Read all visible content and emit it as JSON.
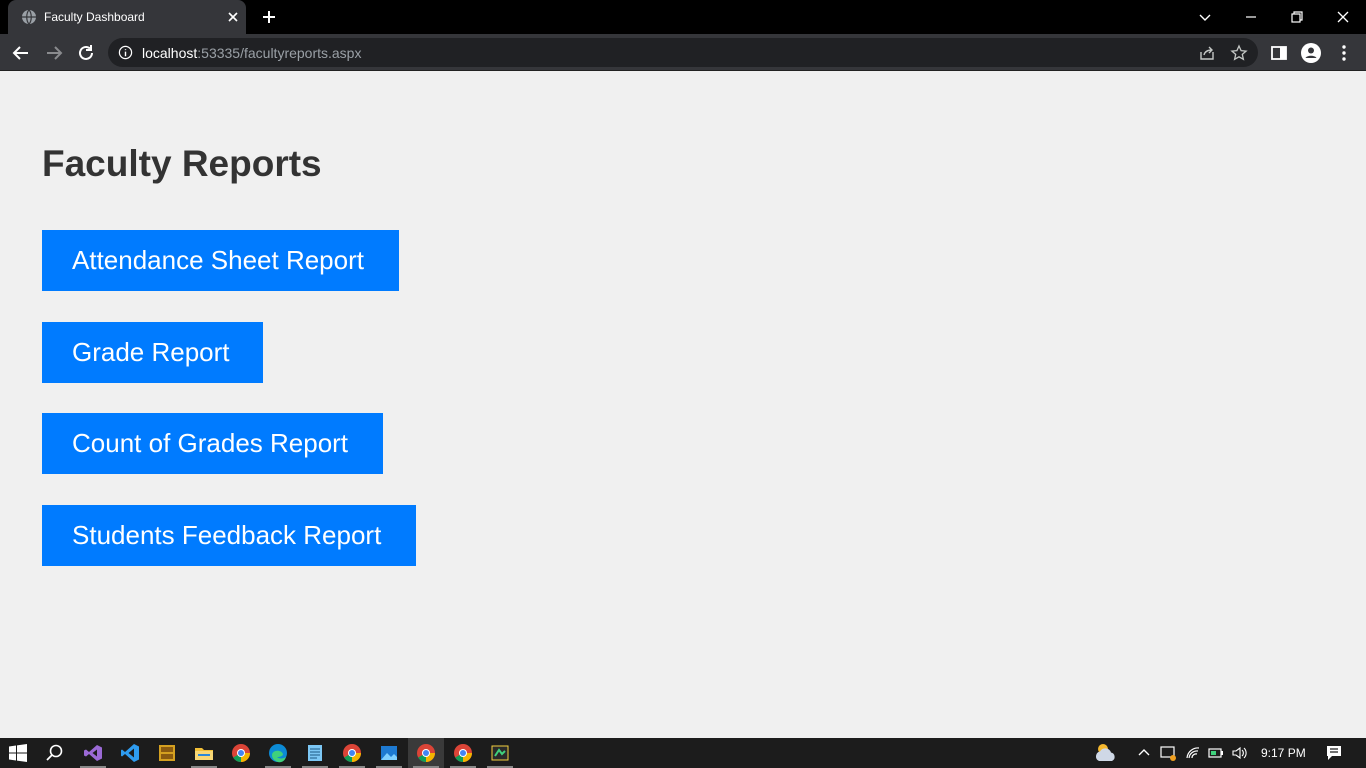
{
  "browser": {
    "tab_title": "Faculty Dashboard",
    "url_host": "localhost",
    "url_rest": ":53335/facultyreports.aspx"
  },
  "page": {
    "title": "Faculty Reports",
    "buttons": [
      {
        "label": "Attendance Sheet Report"
      },
      {
        "label": "Grade Report"
      },
      {
        "label": "Count of Grades Report"
      },
      {
        "label": "Students Feedback Report"
      }
    ]
  },
  "taskbar": {
    "time": "9:17 PM",
    "apps": [
      "visual-studio",
      "vscode",
      "dosbox",
      "file-explorer",
      "chrome",
      "edge",
      "notepad",
      "chrome",
      "photos",
      "chrome",
      "chrome",
      "sticky-app"
    ]
  },
  "colors": {
    "accent": "#007bff",
    "page_bg": "#f0f0f0",
    "title_text": "#333333"
  }
}
